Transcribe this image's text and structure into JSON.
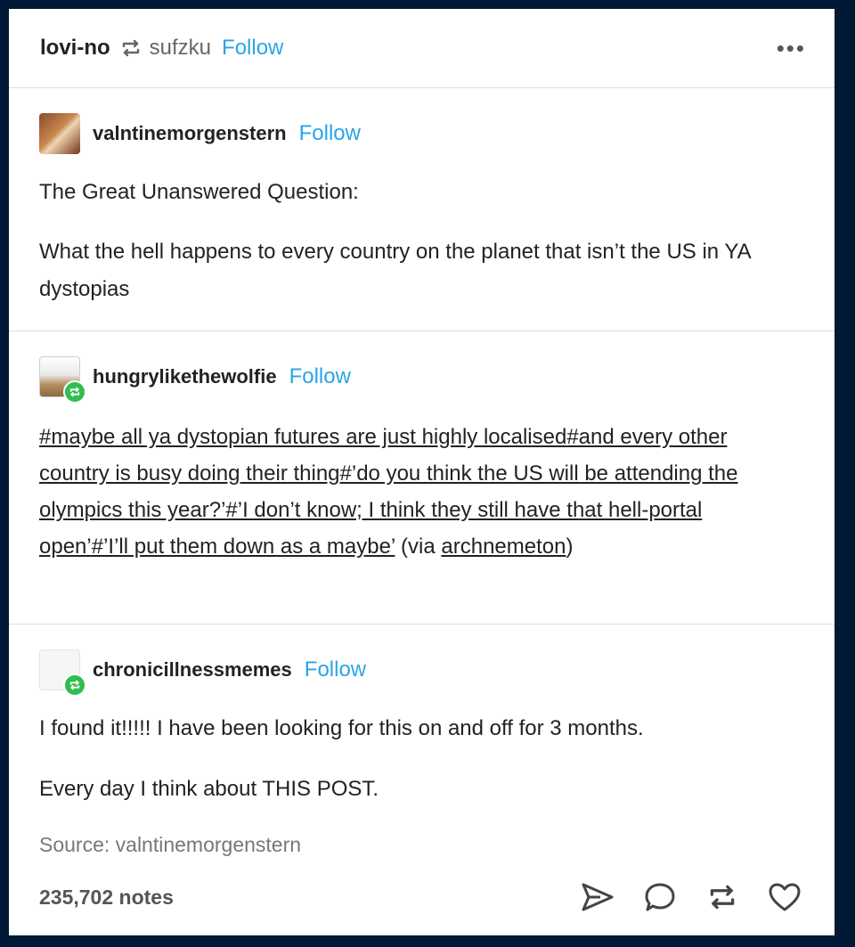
{
  "header": {
    "user": "lovi-no",
    "source_user": "sufzku",
    "follow_label": "Follow",
    "more_label": "•••"
  },
  "posts": [
    {
      "author": "valntinemorgenstern",
      "follow_label": "Follow",
      "paragraphs": [
        "The Great Unanswered Question:",
        "What the hell happens to every country on the planet that isn’t the US in YA dystopias"
      ]
    },
    {
      "author": "hungrylikethewolfie",
      "follow_label": "Follow",
      "tags": [
        "#maybe all ya dystopian futures are just highly localised",
        "#and every other country is busy doing their thing",
        "#’do you think the US will be attending the olympics this year?’",
        "#’I don’t know; I think they still have that hell-portal open’",
        "#’I’ll put them down as a maybe’"
      ],
      "via_prefix": " (via ",
      "via_user": "archnemeton",
      "via_suffix": ")"
    },
    {
      "author": "chronicillnessmemes",
      "follow_label": "Follow",
      "paragraphs": [
        "I found it!!!!!  I have been looking for this on and off for 3 months.",
        "Every day I think about THIS POST."
      ]
    }
  ],
  "source": "Source: valntinemorgenstern",
  "notes": "235,702 notes",
  "icons": {
    "reblog": "reblog-icon",
    "share": "share-icon",
    "reply": "reply-icon",
    "reblog_action": "reblog-icon",
    "like": "heart-icon",
    "more": "more-icon"
  },
  "colors": {
    "background": "#001935",
    "follow": "#2aa4e8",
    "reblog_badge": "#2fbe4f"
  }
}
